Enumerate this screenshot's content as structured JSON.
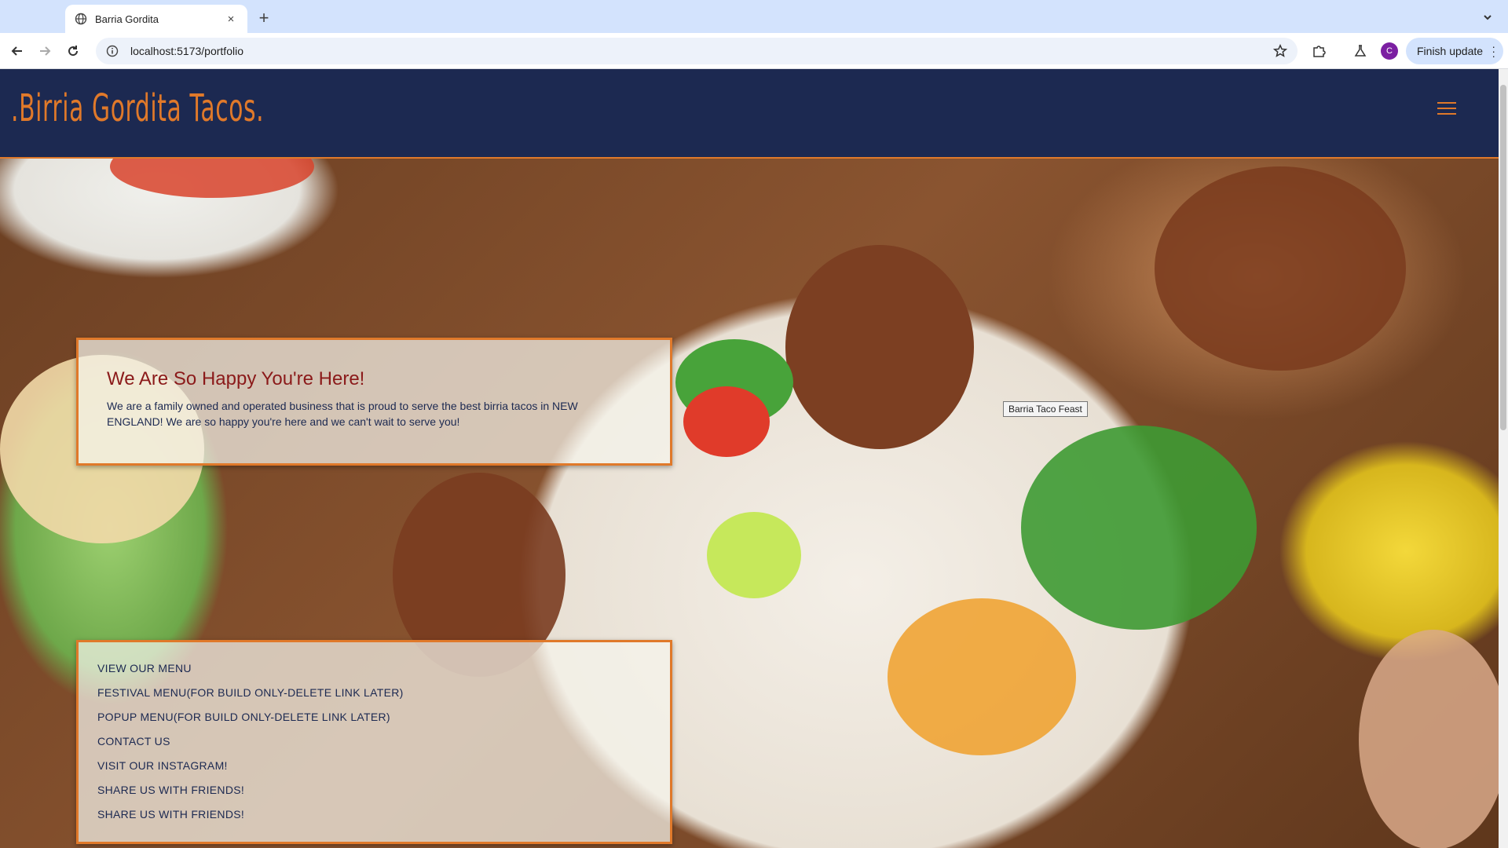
{
  "browser": {
    "tab_title": "Barria Gordita",
    "tab_close": "×",
    "new_tab": "+",
    "url": "localhost:5173/portfolio",
    "profile_initial": "C",
    "update_label": "Finish update"
  },
  "site": {
    "logo": ".Birria Gordita Tacos.",
    "hero_tooltip": "Barria Taco Feast",
    "welcome": {
      "title": "We Are So Happy You're Here!",
      "body": "We are a family owned and operated business that is proud to serve the best birria tacos in NEW ENGLAND! We are so happy you're here and we can't wait to serve you!"
    },
    "links": [
      {
        "label": "VIEW OUR MENU"
      },
      {
        "label": "FESTIVAL MENU(FOR BUILD ONLY-DELETE LINK LATER)"
      },
      {
        "label": "POPUP MENU(FOR BUILD ONLY-DELETE LINK LATER)"
      },
      {
        "label": "CONTACT US"
      },
      {
        "label": "VISIT OUR INSTAGRAM!"
      },
      {
        "label": "SHARE US WITH FRIENDS!"
      },
      {
        "label": "SHARE US WITH FRIENDS!"
      }
    ]
  },
  "colors": {
    "header_bg": "#1c2951",
    "accent_orange": "#e0792a",
    "title_red": "#8b1a1a",
    "chrome_blue": "#d3e3fd"
  }
}
